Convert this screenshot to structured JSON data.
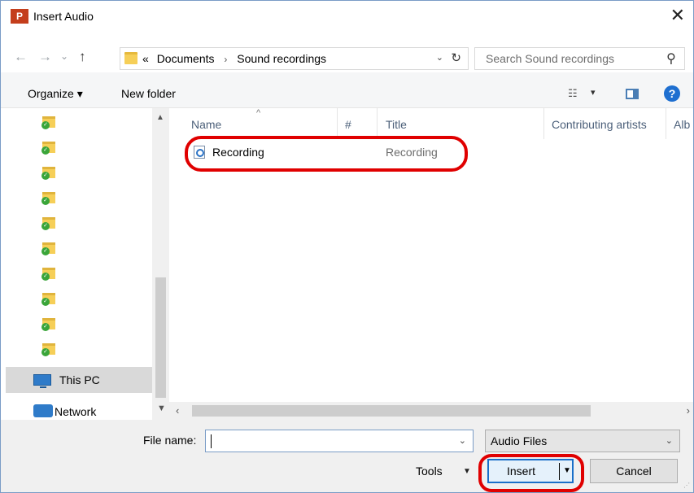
{
  "window": {
    "title": "Insert Audio",
    "app_icon_label": "P",
    "close_glyph": "✕"
  },
  "nav": {
    "back_glyph": "←",
    "forward_glyph": "→",
    "recent_glyph": "⌄",
    "up_glyph": "↑"
  },
  "address": {
    "overflow": "«",
    "crumbs": [
      "Documents",
      "Sound recordings"
    ],
    "separator": "›",
    "dropdown_glyph": "⌄",
    "refresh_glyph": "↻"
  },
  "search": {
    "placeholder": "Search Sound recordings",
    "icon_glyph": "⚲"
  },
  "toolbar": {
    "organize_label": "Organize ▾",
    "new_folder_label": "New folder",
    "view_glyph": "☷",
    "view_drop_glyph": "▾",
    "help_glyph": "?"
  },
  "navpane": {
    "onedrive_folder_count": 10,
    "this_pc_label": "This PC",
    "network_label": "Network"
  },
  "filelist": {
    "columns": [
      "Name",
      "#",
      "Title",
      "Contributing artists",
      "Alb"
    ],
    "sort_glyph": "^",
    "files": [
      {
        "name": "Recording",
        "title": "Recording"
      }
    ]
  },
  "bottom": {
    "file_name_label": "File name:",
    "file_name_value": "",
    "file_type_value": "Audio Files",
    "tools_label": "Tools",
    "insert_label": "Insert",
    "cancel_label": "Cancel",
    "dropdown_glyph": "⌄"
  },
  "colors": {
    "annotation_red": "#e00000",
    "accent_blue": "#1a6fc9",
    "powerpoint_orange": "#c43e1c"
  }
}
